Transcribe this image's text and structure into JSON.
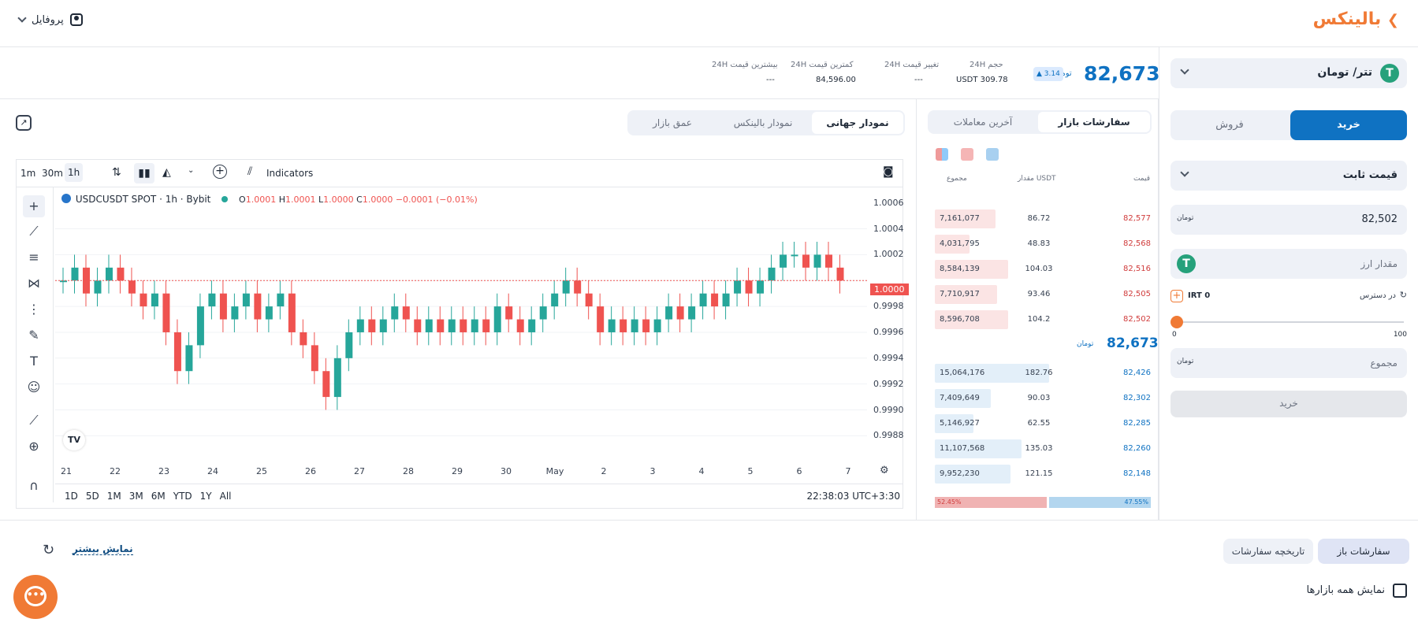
{
  "header": {
    "logo_text": "بالینکس",
    "profile_label": "پروفایل"
  },
  "market": {
    "pair_label": "تتر/ تومان",
    "price": "82,673",
    "currency_symbol": "تومان",
    "change": "3.14",
    "stats": [
      {
        "label": "حجم 24H",
        "value": "309.78 USDT"
      },
      {
        "label": "تغییر قیمت 24H",
        "value": "---"
      },
      {
        "label": "کمترین قیمت 24H",
        "value": "84,596.00"
      },
      {
        "label": "بیشترین قیمت 24H",
        "value": "---"
      }
    ]
  },
  "trade": {
    "buy_tab": "خرید",
    "sell_tab": "فروش",
    "order_type": "قیمت ثابت",
    "price_value": "82,502",
    "amount_placeholder": "مقدار ارز",
    "available_label": "در دسترس",
    "available_value": "IRT 0",
    "slider_min": "0",
    "slider_max": "100",
    "slider_level": 0,
    "total_placeholder": "مجموع",
    "submit_label": "خرید"
  },
  "orderbook": {
    "tab_orders": "سفارشات بازار",
    "tab_trades": "آخرین معاملات",
    "col_price": "قیمت",
    "col_amount": "مقدار USDT",
    "col_total": "مجموع",
    "asks": [
      {
        "total": "7,161,077",
        "amount": "86.72",
        "price": "82,577",
        "depth": 0.28
      },
      {
        "total": "4,031,795",
        "amount": "48.83",
        "price": "82,568",
        "depth": 0.16
      },
      {
        "total": "8,584,139",
        "amount": "104.03",
        "price": "82,516",
        "depth": 0.34
      },
      {
        "total": "7,710,917",
        "amount": "93.46",
        "price": "82,505",
        "depth": 0.29
      },
      {
        "total": "8,596,708",
        "amount": "104.2",
        "price": "82,502",
        "depth": 0.34
      }
    ],
    "last_price": "82,673",
    "bids": [
      {
        "total": "15,064,176",
        "amount": "182.76",
        "price": "82,426",
        "depth": 0.53
      },
      {
        "total": "7,409,649",
        "amount": "90.03",
        "price": "82,302",
        "depth": 0.26
      },
      {
        "total": "5,146,927",
        "amount": "62.55",
        "price": "82,285",
        "depth": 0.18
      },
      {
        "total": "11,107,568",
        "amount": "135.03",
        "price": "82,260",
        "depth": 0.4
      },
      {
        "total": "9,952,230",
        "amount": "121.15",
        "price": "82,148",
        "depth": 0.35
      }
    ],
    "sell_ratio": "52.45%",
    "buy_ratio": "47.55%"
  },
  "chart_tabs": {
    "global": "نمودار جهانی",
    "balinex": "نمودار بالینکس",
    "depth": "عمق بازار"
  },
  "chart_toolbar": {
    "intervals": [
      "1m",
      "30m",
      "1h"
    ],
    "indicators": "Indicators"
  },
  "chart_legend": {
    "symbol": "USDCUSDT SPOT · 1h · Bybit",
    "o_label": "O",
    "o_value": "1.0001",
    "h_label": "H",
    "h_value": "1.0001",
    "l_label": "L",
    "l_value": "1.0000",
    "c_label": "C",
    "c_value": "1.0000 −0.0001 (−0.01%)"
  },
  "chart_data": {
    "type": "candlestick",
    "x_ticks": [
      "21",
      "22",
      "23",
      "24",
      "25",
      "26",
      "27",
      "28",
      "29",
      "30",
      "May",
      "2",
      "3",
      "4",
      "5",
      "6",
      "7"
    ],
    "y_ticks": [
      "1.0006",
      "1.0004",
      "1.0002",
      "0.9998",
      "0.9996",
      "0.9994",
      "0.9992",
      "0.9990",
      "0.9988"
    ],
    "ylim": [
      0.99865,
      1.00072
    ],
    "current_price": "1.0000",
    "close_series": [
      1.0,
      1.0001,
      0.9999,
      1.0,
      1.0001,
      1.0,
      0.9999,
      0.9998,
      0.9999,
      0.9996,
      0.9993,
      0.9995,
      0.9998,
      0.9999,
      0.9997,
      0.9998,
      0.9999,
      0.9997,
      0.9998,
      0.9999,
      0.9996,
      0.9995,
      0.9993,
      0.9991,
      0.9994,
      0.9996,
      0.9997,
      0.9996,
      0.9997,
      0.9998,
      0.9997,
      0.9996,
      0.9997,
      0.9996,
      0.9997,
      0.9996,
      0.9997,
      0.9996,
      0.9998,
      0.9997,
      0.9996,
      0.9997,
      0.9998,
      0.9999,
      1.0,
      0.9999,
      0.9998,
      0.9996,
      0.9997,
      0.9996,
      0.9997,
      0.9996,
      0.9997,
      0.9998,
      0.9997,
      0.9998,
      0.9999,
      0.9998,
      0.9999,
      1.0,
      0.9999,
      1.0,
      1.0001,
      1.0002,
      1.0002,
      1.0001,
      1.0002,
      1.0001,
      1.0
    ],
    "range_buttons": [
      "1D",
      "5D",
      "1M",
      "3M",
      "6M",
      "YTD",
      "1Y",
      "All"
    ],
    "timestamp": "22:38:03 UTC+3:30"
  },
  "bottom": {
    "open_orders": "سفارشات باز",
    "order_history": "تاریخچه سفارشات",
    "show_more": "نمایش بیشتر",
    "show_all_markets": "نمایش همه بازارها"
  },
  "colors": {
    "brand": "#f07a35",
    "buy": "#0f72c2",
    "sell": "#d03b3b",
    "up_candle": "#26a69a",
    "down_candle": "#ef5350"
  }
}
